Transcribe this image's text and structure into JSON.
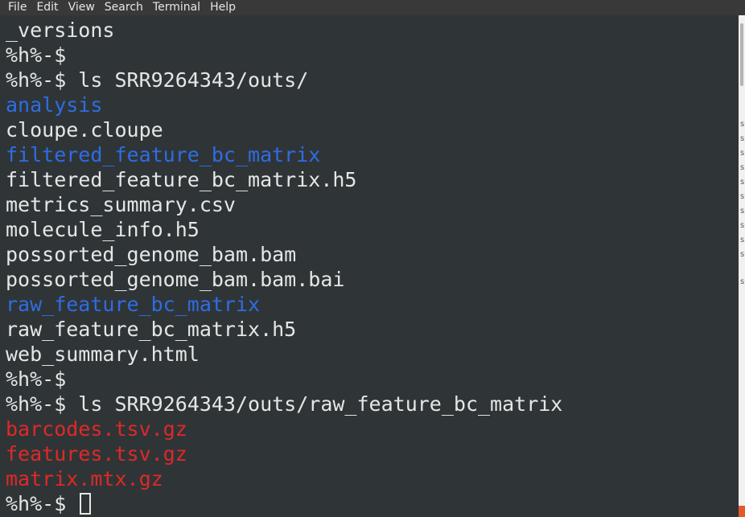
{
  "menu": {
    "items": [
      "File",
      "Edit",
      "View",
      "Search",
      "Terminal",
      "Help"
    ]
  },
  "terminal": {
    "lines": [
      {
        "text": "_versions",
        "kind": "plain"
      },
      {
        "text": "%h%-$",
        "kind": "plain"
      },
      {
        "text": "%h%-$ ls SRR9264343/outs/",
        "kind": "plain"
      },
      {
        "text": "analysis",
        "kind": "dir"
      },
      {
        "text": "cloupe.cloupe",
        "kind": "plain"
      },
      {
        "text": "filtered_feature_bc_matrix",
        "kind": "dir"
      },
      {
        "text": "filtered_feature_bc_matrix.h5",
        "kind": "plain"
      },
      {
        "text": "metrics_summary.csv",
        "kind": "plain"
      },
      {
        "text": "molecule_info.h5",
        "kind": "plain"
      },
      {
        "text": "possorted_genome_bam.bam",
        "kind": "plain"
      },
      {
        "text": "possorted_genome_bam.bam.bai",
        "kind": "plain"
      },
      {
        "text": "raw_feature_bc_matrix",
        "kind": "dir"
      },
      {
        "text": "raw_feature_bc_matrix.h5",
        "kind": "plain"
      },
      {
        "text": "web_summary.html",
        "kind": "plain"
      },
      {
        "text": "%h%-$",
        "kind": "plain"
      },
      {
        "text": "%h%-$ ls SRR9264343/outs/raw_feature_bc_matrix",
        "kind": "plain"
      },
      {
        "text": "barcodes.tsv.gz",
        "kind": "archive"
      },
      {
        "text": "features.tsv.gz",
        "kind": "archive"
      },
      {
        "text": "matrix.mtx.gz",
        "kind": "archive"
      },
      {
        "text": "%h%-$ ",
        "kind": "prompt"
      }
    ]
  },
  "colors": {
    "background": "#2f3537",
    "text": "#e6e6e6",
    "directory": "#2f6ce4",
    "archive": "#e02828"
  }
}
